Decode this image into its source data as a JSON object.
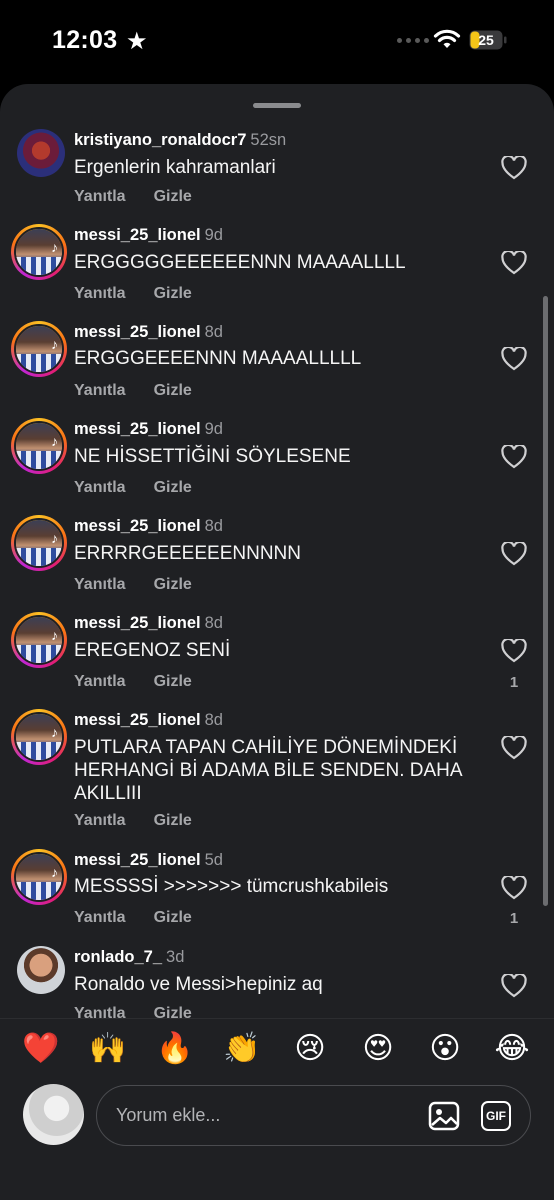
{
  "status": {
    "time": "12:03",
    "battery": "25"
  },
  "comments": [
    {
      "user": "kristiyano_ronaldocr7",
      "ago": "52sn",
      "text": "Ergenlerin kahramanlari",
      "reply": "Yanıtla",
      "hide": "Gizle",
      "likes": ""
    },
    {
      "user": "messi_25_lionel",
      "ago": "9d",
      "text": "ERGGGGGEEEEEENNN MAAAALLLL",
      "reply": "Yanıtla",
      "hide": "Gizle",
      "likes": ""
    },
    {
      "user": "messi_25_lionel",
      "ago": "8d",
      "text": "ERGGGEEEENNN MAAAALLLLL",
      "reply": "Yanıtla",
      "hide": "Gizle",
      "likes": ""
    },
    {
      "user": "messi_25_lionel",
      "ago": "9d",
      "text": "NE HİSSETTİĞİNİ SÖYLESENE",
      "reply": "Yanıtla",
      "hide": "Gizle",
      "likes": ""
    },
    {
      "user": "messi_25_lionel",
      "ago": "8d",
      "text": "ERRRRGEEEEEENNNNN",
      "reply": "Yanıtla",
      "hide": "Gizle",
      "likes": ""
    },
    {
      "user": "messi_25_lionel",
      "ago": "8d",
      "text": "EREGENOZ SENİ",
      "reply": "Yanıtla",
      "hide": "Gizle",
      "likes": "1"
    },
    {
      "user": "messi_25_lionel",
      "ago": "8d",
      "text": "PUTLARA TAPAN CAHİLİYE DÖNEMİNDEKİ HERHANGİ Bİ ADAMA BİLE SENDEN. DAHA AKILLIII",
      "reply": "Yanıtla",
      "hide": "Gizle",
      "likes": ""
    },
    {
      "user": "messi_25_lionel",
      "ago": "5d",
      "text": "MESSSSİ >>>>>>> tümcrushkabileis",
      "reply": "Yanıtla",
      "hide": "Gizle",
      "likes": "1"
    },
    {
      "user": "ronlado_7_",
      "ago": "3d",
      "text": "Ronaldo ve Messi>hepiniz aq",
      "reply": "Yanıtla",
      "hide": "Gizle",
      "likes": ""
    }
  ],
  "emojis": [
    "❤️",
    "🙌",
    "🔥",
    "👏",
    "😢",
    "😍",
    "😮",
    "😂"
  ],
  "composer": {
    "placeholder": "Yorum ekle...",
    "gif_label": "GIF"
  },
  "icons": [
    "star-icon",
    "wifi-icon",
    "battery-icon",
    "heart-icon",
    "image-icon",
    "gif-icon"
  ],
  "colors": {
    "sheet": "#1f2023",
    "muted": "#a7a8ab"
  }
}
